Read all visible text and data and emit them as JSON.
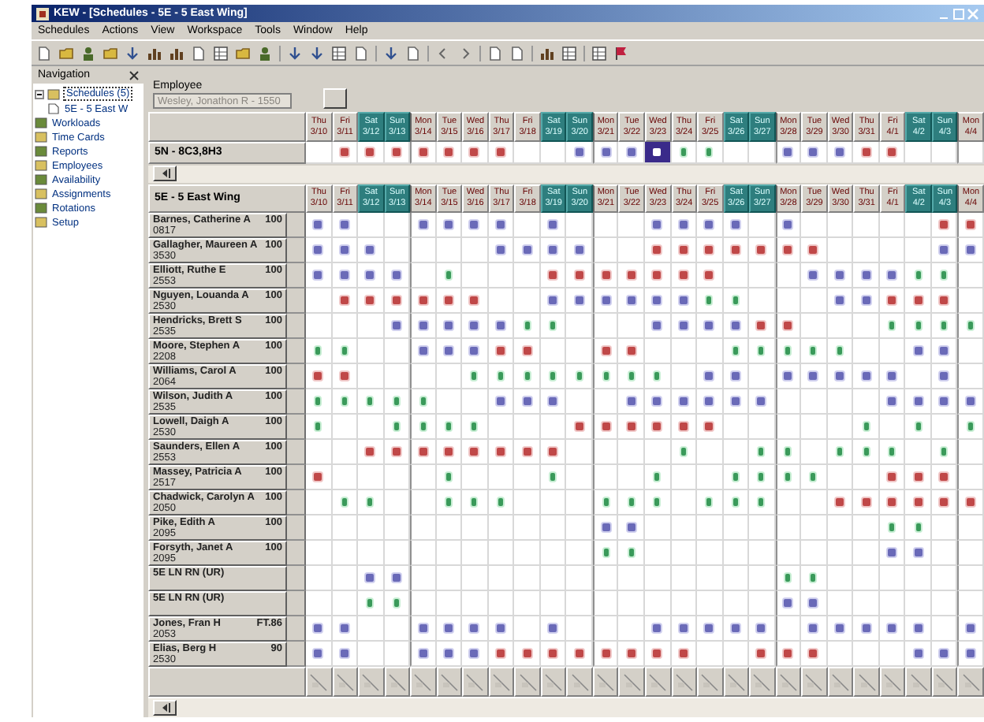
{
  "window": {
    "title": "KEW - [Schedules - 5E - 5 East Wing]"
  },
  "menu": [
    "Schedules",
    "Actions",
    "View",
    "Workspace",
    "Tools",
    "Window",
    "Help"
  ],
  "navigation": {
    "title": "Navigation",
    "items": [
      {
        "label": "Schedules (5)",
        "selected": true,
        "expanded": true,
        "children": [
          {
            "label": "5E - 5 East W",
            "selected": false
          }
        ]
      },
      {
        "label": "Workloads",
        "selected": false
      },
      {
        "label": "Time Cards",
        "selected": false
      },
      {
        "label": "Reports",
        "selected": false
      },
      {
        "label": "Employees",
        "selected": false
      },
      {
        "label": "Availability",
        "selected": false
      },
      {
        "label": "Assignments",
        "selected": false
      },
      {
        "label": "Rotations",
        "selected": false
      },
      {
        "label": "Setup",
        "selected": false
      }
    ]
  },
  "employee": {
    "label": "Employee",
    "value": "Wesley, Jonathon R - 1550",
    "disabled": true
  },
  "days": [
    {
      "day": "Thu",
      "date": "3/10",
      "weekend": false
    },
    {
      "day": "Fri",
      "date": "3/11",
      "weekend": false
    },
    {
      "day": "Sat",
      "date": "3/12",
      "weekend": true
    },
    {
      "day": "Sun",
      "date": "3/13",
      "weekend": true
    },
    {
      "day": "Mon",
      "date": "3/14",
      "weekend": false
    },
    {
      "day": "Tue",
      "date": "3/15",
      "weekend": false
    },
    {
      "day": "Wed",
      "date": "3/16",
      "weekend": false
    },
    {
      "day": "Thu",
      "date": "3/17",
      "weekend": false
    },
    {
      "day": "Fri",
      "date": "3/18",
      "weekend": false
    },
    {
      "day": "Sat",
      "date": "3/19",
      "weekend": true
    },
    {
      "day": "Sun",
      "date": "3/20",
      "weekend": true
    },
    {
      "day": "Mon",
      "date": "3/21",
      "weekend": false
    },
    {
      "day": "Tue",
      "date": "3/22",
      "weekend": false
    },
    {
      "day": "Wed",
      "date": "3/23",
      "weekend": false
    },
    {
      "day": "Thu",
      "date": "3/24",
      "weekend": false
    },
    {
      "day": "Fri",
      "date": "3/25",
      "weekend": false
    },
    {
      "day": "Sat",
      "date": "3/26",
      "weekend": true
    },
    {
      "day": "Sun",
      "date": "3/27",
      "weekend": true
    },
    {
      "day": "Mon",
      "date": "3/28",
      "weekend": false
    },
    {
      "day": "Tue",
      "date": "3/29",
      "weekend": false
    },
    {
      "day": "Wed",
      "date": "3/30",
      "weekend": false
    },
    {
      "day": "Thu",
      "date": "3/31",
      "weekend": false
    },
    {
      "day": "Fri",
      "date": "4/1",
      "weekend": false
    },
    {
      "day": "Sat",
      "date": "4/2",
      "weekend": true
    },
    {
      "day": "Sun",
      "date": "4/3",
      "weekend": true
    },
    {
      "day": "Mon",
      "date": "4/4",
      "weekend": false
    }
  ],
  "unit_row": {
    "label": "5N - 8C3,8H3",
    "cells": [
      {
        "kind": "off",
        "selected": false
      },
      {
        "kind": "night",
        "selected": false
      },
      {
        "kind": "night",
        "selected": false
      },
      {
        "kind": "night",
        "selected": false
      },
      {
        "kind": "night",
        "selected": false
      },
      {
        "kind": "night",
        "selected": false
      },
      {
        "kind": "night",
        "selected": false
      },
      {
        "kind": "night",
        "selected": false
      },
      {
        "kind": "off",
        "selected": false
      },
      {
        "kind": "off",
        "selected": false
      },
      {
        "kind": "day",
        "selected": false
      },
      {
        "kind": "day",
        "selected": false
      },
      {
        "kind": "day",
        "selected": false
      },
      {
        "kind": "day",
        "selected": true
      },
      {
        "kind": "eve",
        "selected": false
      },
      {
        "kind": "eve",
        "selected": false
      },
      {
        "kind": "off",
        "selected": false
      },
      {
        "kind": "off",
        "selected": false
      },
      {
        "kind": "day",
        "selected": false
      },
      {
        "kind": "day",
        "selected": false
      },
      {
        "kind": "day",
        "selected": false
      },
      {
        "kind": "night",
        "selected": false
      },
      {
        "kind": "night",
        "selected": false
      },
      {
        "kind": "off",
        "selected": false
      },
      {
        "kind": "off",
        "selected": false
      },
      {
        "kind": "off",
        "selected": false
      }
    ]
  },
  "schedule": {
    "title": "5E - 5 East Wing",
    "days": [
      {
        "day": "Thu",
        "date": "3/10",
        "weekend": false
      },
      {
        "day": "Fri",
        "date": "3/11",
        "weekend": false
      },
      {
        "day": "Sat",
        "date": "3/12",
        "weekend": true
      },
      {
        "day": "Sun",
        "date": "3/13",
        "weekend": true
      },
      {
        "day": "Mon",
        "date": "3/14",
        "weekend": false
      },
      {
        "day": "Tue",
        "date": "3/15",
        "weekend": false
      },
      {
        "day": "Wed",
        "date": "3/16",
        "weekend": false
      },
      {
        "day": "Thu",
        "date": "3/17",
        "weekend": false
      },
      {
        "day": "Fri",
        "date": "3/18",
        "weekend": false
      },
      {
        "day": "Sat",
        "date": "3/19",
        "weekend": true
      },
      {
        "day": "Sun",
        "date": "3/20",
        "weekend": true
      },
      {
        "day": "Mon",
        "date": "3/21",
        "weekend": false
      },
      {
        "day": "Tue",
        "date": "3/22",
        "weekend": false
      },
      {
        "day": "Wed",
        "date": "3/23",
        "weekend": false
      },
      {
        "day": "Thu",
        "date": "3/24",
        "weekend": false
      },
      {
        "day": "Fri",
        "date": "3/25",
        "weekend": false
      },
      {
        "day": "Sat",
        "date": "3/26",
        "weekend": true
      },
      {
        "day": "Sun",
        "date": "3/27",
        "weekend": true
      },
      {
        "day": "Mon",
        "date": "3/28",
        "weekend": false
      },
      {
        "day": "Tue",
        "date": "3/29",
        "weekend": false
      },
      {
        "day": "Wed",
        "date": "3/30",
        "weekend": false
      },
      {
        "day": "Thu",
        "date": "3/31",
        "weekend": false
      },
      {
        "day": "Fri",
        "date": "4/1",
        "weekend": false
      },
      {
        "day": "Sat",
        "date": "4/2",
        "weekend": true
      },
      {
        "day": "Sun",
        "date": "4/3",
        "weekend": true
      },
      {
        "day": "Mon",
        "date": "4/4",
        "weekend": false
      }
    ],
    "rows": [
      {
        "name": "Barnes, Catherine A",
        "id": "0817",
        "fte": "100",
        "cells": [
          {
            "kind": "day"
          },
          {
            "kind": "day"
          },
          {
            "kind": "off"
          },
          {
            "kind": "off"
          },
          {
            "kind": "day"
          },
          {
            "kind": "day"
          },
          {
            "kind": "day"
          },
          {
            "kind": "day"
          },
          {
            "kind": "off"
          },
          {
            "kind": "day"
          },
          {
            "kind": "off"
          },
          {
            "kind": "off"
          },
          {
            "kind": "off"
          },
          {
            "kind": "day"
          },
          {
            "kind": "day"
          },
          {
            "kind": "day"
          },
          {
            "kind": "day"
          },
          {
            "kind": "off"
          },
          {
            "kind": "day"
          },
          {
            "kind": "off"
          },
          {
            "kind": "off"
          },
          {
            "kind": "off"
          },
          {
            "kind": "off"
          },
          {
            "kind": "off"
          },
          {
            "kind": "night"
          },
          {
            "kind": "night"
          }
        ]
      },
      {
        "name": "Gallagher, Maureen A",
        "id": "3530",
        "fte": "100",
        "cells": [
          {
            "kind": "day"
          },
          {
            "kind": "day"
          },
          {
            "kind": "day"
          },
          {
            "kind": "off"
          },
          {
            "kind": "off"
          },
          {
            "kind": "off"
          },
          {
            "kind": "off"
          },
          {
            "kind": "day"
          },
          {
            "kind": "day"
          },
          {
            "kind": "day"
          },
          {
            "kind": "day"
          },
          {
            "kind": "off"
          },
          {
            "kind": "off"
          },
          {
            "kind": "night"
          },
          {
            "kind": "night"
          },
          {
            "kind": "night"
          },
          {
            "kind": "night"
          },
          {
            "kind": "night"
          },
          {
            "kind": "night"
          },
          {
            "kind": "night"
          },
          {
            "kind": "off"
          },
          {
            "kind": "off"
          },
          {
            "kind": "off"
          },
          {
            "kind": "off"
          },
          {
            "kind": "day"
          },
          {
            "kind": "day"
          }
        ]
      },
      {
        "name": "Elliott, Ruthe E",
        "id": "2553",
        "fte": "100",
        "cells": [
          {
            "kind": "day"
          },
          {
            "kind": "day"
          },
          {
            "kind": "day"
          },
          {
            "kind": "day"
          },
          {
            "kind": "off"
          },
          {
            "kind": "eve"
          },
          {
            "kind": "off"
          },
          {
            "kind": "off"
          },
          {
            "kind": "off"
          },
          {
            "kind": "night"
          },
          {
            "kind": "night"
          },
          {
            "kind": "night"
          },
          {
            "kind": "night"
          },
          {
            "kind": "night"
          },
          {
            "kind": "night"
          },
          {
            "kind": "night"
          },
          {
            "kind": "off"
          },
          {
            "kind": "off"
          },
          {
            "kind": "off"
          },
          {
            "kind": "day"
          },
          {
            "kind": "day"
          },
          {
            "kind": "day"
          },
          {
            "kind": "day"
          },
          {
            "kind": "eve"
          },
          {
            "kind": "eve"
          },
          {
            "kind": "off"
          }
        ]
      },
      {
        "name": "Nguyen, Louanda A",
        "id": "2530",
        "fte": "100",
        "cells": [
          {
            "kind": "off"
          },
          {
            "kind": "night"
          },
          {
            "kind": "night"
          },
          {
            "kind": "night"
          },
          {
            "kind": "night"
          },
          {
            "kind": "night"
          },
          {
            "kind": "night"
          },
          {
            "kind": "off"
          },
          {
            "kind": "off"
          },
          {
            "kind": "day"
          },
          {
            "kind": "day"
          },
          {
            "kind": "day"
          },
          {
            "kind": "day"
          },
          {
            "kind": "day"
          },
          {
            "kind": "day"
          },
          {
            "kind": "eve"
          },
          {
            "kind": "eve"
          },
          {
            "kind": "off"
          },
          {
            "kind": "off"
          },
          {
            "kind": "off"
          },
          {
            "kind": "day"
          },
          {
            "kind": "day"
          },
          {
            "kind": "night"
          },
          {
            "kind": "night"
          },
          {
            "kind": "night"
          },
          {
            "kind": "off"
          }
        ]
      },
      {
        "name": "Hendricks, Brett S",
        "id": "2535",
        "fte": "100",
        "cells": [
          {
            "kind": "off"
          },
          {
            "kind": "off"
          },
          {
            "kind": "off"
          },
          {
            "kind": "day"
          },
          {
            "kind": "day"
          },
          {
            "kind": "day"
          },
          {
            "kind": "day"
          },
          {
            "kind": "day"
          },
          {
            "kind": "eve"
          },
          {
            "kind": "eve"
          },
          {
            "kind": "off"
          },
          {
            "kind": "off"
          },
          {
            "kind": "off"
          },
          {
            "kind": "day"
          },
          {
            "kind": "day"
          },
          {
            "kind": "day"
          },
          {
            "kind": "day"
          },
          {
            "kind": "night"
          },
          {
            "kind": "night"
          },
          {
            "kind": "off"
          },
          {
            "kind": "off"
          },
          {
            "kind": "off"
          },
          {
            "kind": "eve"
          },
          {
            "kind": "eve"
          },
          {
            "kind": "eve"
          },
          {
            "kind": "eve"
          }
        ]
      },
      {
        "name": "Moore, Stephen A",
        "id": "2208",
        "fte": "100",
        "cells": [
          {
            "kind": "eve"
          },
          {
            "kind": "eve"
          },
          {
            "kind": "off"
          },
          {
            "kind": "off"
          },
          {
            "kind": "day"
          },
          {
            "kind": "day"
          },
          {
            "kind": "day"
          },
          {
            "kind": "night"
          },
          {
            "kind": "night"
          },
          {
            "kind": "off"
          },
          {
            "kind": "off"
          },
          {
            "kind": "night"
          },
          {
            "kind": "night"
          },
          {
            "kind": "off"
          },
          {
            "kind": "off"
          },
          {
            "kind": "off"
          },
          {
            "kind": "eve"
          },
          {
            "kind": "eve"
          },
          {
            "kind": "eve"
          },
          {
            "kind": "eve"
          },
          {
            "kind": "eve"
          },
          {
            "kind": "off"
          },
          {
            "kind": "off"
          },
          {
            "kind": "day"
          },
          {
            "kind": "day"
          },
          {
            "kind": "off"
          }
        ]
      },
      {
        "name": "Williams, Carol A",
        "id": "2064",
        "fte": "100",
        "cells": [
          {
            "kind": "night"
          },
          {
            "kind": "night"
          },
          {
            "kind": "off"
          },
          {
            "kind": "off"
          },
          {
            "kind": "off"
          },
          {
            "kind": "off"
          },
          {
            "kind": "eve"
          },
          {
            "kind": "eve"
          },
          {
            "kind": "eve"
          },
          {
            "kind": "eve"
          },
          {
            "kind": "eve"
          },
          {
            "kind": "eve"
          },
          {
            "kind": "eve"
          },
          {
            "kind": "eve"
          },
          {
            "kind": "off"
          },
          {
            "kind": "day"
          },
          {
            "kind": "day"
          },
          {
            "kind": "off"
          },
          {
            "kind": "day"
          },
          {
            "kind": "day"
          },
          {
            "kind": "day"
          },
          {
            "kind": "day"
          },
          {
            "kind": "day"
          },
          {
            "kind": "off"
          },
          {
            "kind": "day"
          },
          {
            "kind": "off"
          }
        ]
      },
      {
        "name": "Wilson, Judith A",
        "id": "2535",
        "fte": "100",
        "cells": [
          {
            "kind": "eve"
          },
          {
            "kind": "eve"
          },
          {
            "kind": "eve"
          },
          {
            "kind": "eve"
          },
          {
            "kind": "eve"
          },
          {
            "kind": "off"
          },
          {
            "kind": "off"
          },
          {
            "kind": "day"
          },
          {
            "kind": "day"
          },
          {
            "kind": "day"
          },
          {
            "kind": "off"
          },
          {
            "kind": "off"
          },
          {
            "kind": "day"
          },
          {
            "kind": "day"
          },
          {
            "kind": "day"
          },
          {
            "kind": "day"
          },
          {
            "kind": "day"
          },
          {
            "kind": "day"
          },
          {
            "kind": "off"
          },
          {
            "kind": "off"
          },
          {
            "kind": "off"
          },
          {
            "kind": "off"
          },
          {
            "kind": "day"
          },
          {
            "kind": "day"
          },
          {
            "kind": "day"
          },
          {
            "kind": "day"
          }
        ]
      },
      {
        "name": "Lowell, Daigh A",
        "id": "2530",
        "fte": "100",
        "cells": [
          {
            "kind": "eve"
          },
          {
            "kind": "off"
          },
          {
            "kind": "off"
          },
          {
            "kind": "eve"
          },
          {
            "kind": "eve"
          },
          {
            "kind": "eve"
          },
          {
            "kind": "eve"
          },
          {
            "kind": "off"
          },
          {
            "kind": "off"
          },
          {
            "kind": "off"
          },
          {
            "kind": "night"
          },
          {
            "kind": "night"
          },
          {
            "kind": "night"
          },
          {
            "kind": "night"
          },
          {
            "kind": "night"
          },
          {
            "kind": "night"
          },
          {
            "kind": "off"
          },
          {
            "kind": "off"
          },
          {
            "kind": "off"
          },
          {
            "kind": "off"
          },
          {
            "kind": "off"
          },
          {
            "kind": "eve"
          },
          {
            "kind": "off"
          },
          {
            "kind": "eve"
          },
          {
            "kind": "off"
          },
          {
            "kind": "eve"
          }
        ]
      },
      {
        "name": "Saunders, Ellen A",
        "id": "2553",
        "fte": "100",
        "cells": [
          {
            "kind": "off"
          },
          {
            "kind": "off"
          },
          {
            "kind": "night"
          },
          {
            "kind": "night"
          },
          {
            "kind": "night"
          },
          {
            "kind": "night"
          },
          {
            "kind": "night"
          },
          {
            "kind": "night"
          },
          {
            "kind": "night"
          },
          {
            "kind": "night"
          },
          {
            "kind": "off"
          },
          {
            "kind": "off"
          },
          {
            "kind": "off"
          },
          {
            "kind": "off"
          },
          {
            "kind": "eve"
          },
          {
            "kind": "off"
          },
          {
            "kind": "off"
          },
          {
            "kind": "eve"
          },
          {
            "kind": "eve"
          },
          {
            "kind": "off"
          },
          {
            "kind": "eve"
          },
          {
            "kind": "eve"
          },
          {
            "kind": "eve"
          },
          {
            "kind": "off"
          },
          {
            "kind": "eve"
          },
          {
            "kind": "off"
          }
        ]
      },
      {
        "name": "Massey, Patricia A",
        "id": "2517",
        "fte": "100",
        "cells": [
          {
            "kind": "night"
          },
          {
            "kind": "off"
          },
          {
            "kind": "off"
          },
          {
            "kind": "off"
          },
          {
            "kind": "off"
          },
          {
            "kind": "eve"
          },
          {
            "kind": "off"
          },
          {
            "kind": "off"
          },
          {
            "kind": "off"
          },
          {
            "kind": "eve"
          },
          {
            "kind": "off"
          },
          {
            "kind": "off"
          },
          {
            "kind": "off"
          },
          {
            "kind": "eve"
          },
          {
            "kind": "off"
          },
          {
            "kind": "off"
          },
          {
            "kind": "eve"
          },
          {
            "kind": "eve"
          },
          {
            "kind": "eve"
          },
          {
            "kind": "eve"
          },
          {
            "kind": "off"
          },
          {
            "kind": "off"
          },
          {
            "kind": "night"
          },
          {
            "kind": "night"
          },
          {
            "kind": "night"
          },
          {
            "kind": "off"
          }
        ]
      },
      {
        "name": "Chadwick, Carolyn A",
        "id": "2050",
        "fte": "100",
        "cells": [
          {
            "kind": "off"
          },
          {
            "kind": "eve"
          },
          {
            "kind": "eve"
          },
          {
            "kind": "off"
          },
          {
            "kind": "off"
          },
          {
            "kind": "eve"
          },
          {
            "kind": "eve"
          },
          {
            "kind": "eve"
          },
          {
            "kind": "off"
          },
          {
            "kind": "off"
          },
          {
            "kind": "off"
          },
          {
            "kind": "eve"
          },
          {
            "kind": "eve"
          },
          {
            "kind": "eve"
          },
          {
            "kind": "off"
          },
          {
            "kind": "eve"
          },
          {
            "kind": "eve"
          },
          {
            "kind": "eve"
          },
          {
            "kind": "off"
          },
          {
            "kind": "off"
          },
          {
            "kind": "night"
          },
          {
            "kind": "night"
          },
          {
            "kind": "night"
          },
          {
            "kind": "night"
          },
          {
            "kind": "night"
          },
          {
            "kind": "night"
          }
        ]
      },
      {
        "name": "Pike, Edith A",
        "id": "2095",
        "fte": "100",
        "cells": [
          {
            "kind": "off"
          },
          {
            "kind": "off"
          },
          {
            "kind": "off"
          },
          {
            "kind": "off"
          },
          {
            "kind": "off"
          },
          {
            "kind": "off"
          },
          {
            "kind": "off"
          },
          {
            "kind": "off"
          },
          {
            "kind": "off"
          },
          {
            "kind": "off"
          },
          {
            "kind": "off"
          },
          {
            "kind": "day"
          },
          {
            "kind": "day"
          },
          {
            "kind": "off"
          },
          {
            "kind": "off"
          },
          {
            "kind": "off"
          },
          {
            "kind": "off"
          },
          {
            "kind": "off"
          },
          {
            "kind": "off"
          },
          {
            "kind": "off"
          },
          {
            "kind": "off"
          },
          {
            "kind": "off"
          },
          {
            "kind": "eve"
          },
          {
            "kind": "eve"
          },
          {
            "kind": "off"
          },
          {
            "kind": "off"
          }
        ]
      },
      {
        "name": "Forsyth, Janet A",
        "id": "2095",
        "fte": "100",
        "cells": [
          {
            "kind": "off"
          },
          {
            "kind": "off"
          },
          {
            "kind": "off"
          },
          {
            "kind": "off"
          },
          {
            "kind": "off"
          },
          {
            "kind": "off"
          },
          {
            "kind": "off"
          },
          {
            "kind": "off"
          },
          {
            "kind": "off"
          },
          {
            "kind": "off"
          },
          {
            "kind": "off"
          },
          {
            "kind": "eve"
          },
          {
            "kind": "eve"
          },
          {
            "kind": "off"
          },
          {
            "kind": "off"
          },
          {
            "kind": "off"
          },
          {
            "kind": "off"
          },
          {
            "kind": "off"
          },
          {
            "kind": "off"
          },
          {
            "kind": "off"
          },
          {
            "kind": "off"
          },
          {
            "kind": "off"
          },
          {
            "kind": "day"
          },
          {
            "kind": "day"
          },
          {
            "kind": "off"
          },
          {
            "kind": "off"
          }
        ]
      },
      {
        "name": "5E LN RN (UR)",
        "cells": [
          {
            "kind": "off"
          },
          {
            "kind": "off"
          },
          {
            "kind": "day"
          },
          {
            "kind": "day"
          },
          {
            "kind": "off"
          },
          {
            "kind": "off"
          },
          {
            "kind": "off"
          },
          {
            "kind": "off"
          },
          {
            "kind": "off"
          },
          {
            "kind": "off"
          },
          {
            "kind": "off"
          },
          {
            "kind": "off"
          },
          {
            "kind": "off"
          },
          {
            "kind": "off"
          },
          {
            "kind": "off"
          },
          {
            "kind": "off"
          },
          {
            "kind": "off"
          },
          {
            "kind": "off"
          },
          {
            "kind": "eve"
          },
          {
            "kind": "eve"
          },
          {
            "kind": "off"
          },
          {
            "kind": "off"
          },
          {
            "kind": "off"
          },
          {
            "kind": "off"
          },
          {
            "kind": "off"
          },
          {
            "kind": "off"
          }
        ]
      },
      {
        "name": "5E LN RN (UR)",
        "cells": [
          {
            "kind": "off"
          },
          {
            "kind": "off"
          },
          {
            "kind": "eve"
          },
          {
            "kind": "eve"
          },
          {
            "kind": "off"
          },
          {
            "kind": "off"
          },
          {
            "kind": "off"
          },
          {
            "kind": "off"
          },
          {
            "kind": "off"
          },
          {
            "kind": "off"
          },
          {
            "kind": "off"
          },
          {
            "kind": "off"
          },
          {
            "kind": "off"
          },
          {
            "kind": "off"
          },
          {
            "kind": "off"
          },
          {
            "kind": "off"
          },
          {
            "kind": "off"
          },
          {
            "kind": "off"
          },
          {
            "kind": "day"
          },
          {
            "kind": "day"
          },
          {
            "kind": "off"
          },
          {
            "kind": "off"
          },
          {
            "kind": "off"
          },
          {
            "kind": "off"
          },
          {
            "kind": "off"
          },
          {
            "kind": "off"
          }
        ]
      },
      {
        "name": "Jones, Fran H",
        "id": "2053",
        "fte": "FT.86",
        "cells": [
          {
            "kind": "day"
          },
          {
            "kind": "day"
          },
          {
            "kind": "off"
          },
          {
            "kind": "off"
          },
          {
            "kind": "day"
          },
          {
            "kind": "day"
          },
          {
            "kind": "day"
          },
          {
            "kind": "day"
          },
          {
            "kind": "off"
          },
          {
            "kind": "day"
          },
          {
            "kind": "off"
          },
          {
            "kind": "off"
          },
          {
            "kind": "off"
          },
          {
            "kind": "day"
          },
          {
            "kind": "day"
          },
          {
            "kind": "day"
          },
          {
            "kind": "day"
          },
          {
            "kind": "day"
          },
          {
            "kind": "off"
          },
          {
            "kind": "day"
          },
          {
            "kind": "day"
          },
          {
            "kind": "day"
          },
          {
            "kind": "day"
          },
          {
            "kind": "day"
          },
          {
            "kind": "off"
          },
          {
            "kind": "day"
          }
        ]
      },
      {
        "name": "Elias, Berg H",
        "id": "2530",
        "fte": "90",
        "cells": [
          {
            "kind": "day"
          },
          {
            "kind": "day"
          },
          {
            "kind": "off"
          },
          {
            "kind": "off"
          },
          {
            "kind": "day"
          },
          {
            "kind": "day"
          },
          {
            "kind": "day"
          },
          {
            "kind": "night"
          },
          {
            "kind": "night"
          },
          {
            "kind": "night"
          },
          {
            "kind": "night"
          },
          {
            "kind": "night"
          },
          {
            "kind": "night"
          },
          {
            "kind": "night"
          },
          {
            "kind": "night"
          },
          {
            "kind": "off"
          },
          {
            "kind": "off"
          },
          {
            "kind": "night"
          },
          {
            "kind": "night"
          },
          {
            "kind": "night"
          },
          {
            "kind": "off"
          },
          {
            "kind": "off"
          },
          {
            "kind": "off"
          },
          {
            "kind": "day"
          },
          {
            "kind": "day"
          },
          {
            "kind": "day"
          }
        ]
      }
    ]
  }
}
